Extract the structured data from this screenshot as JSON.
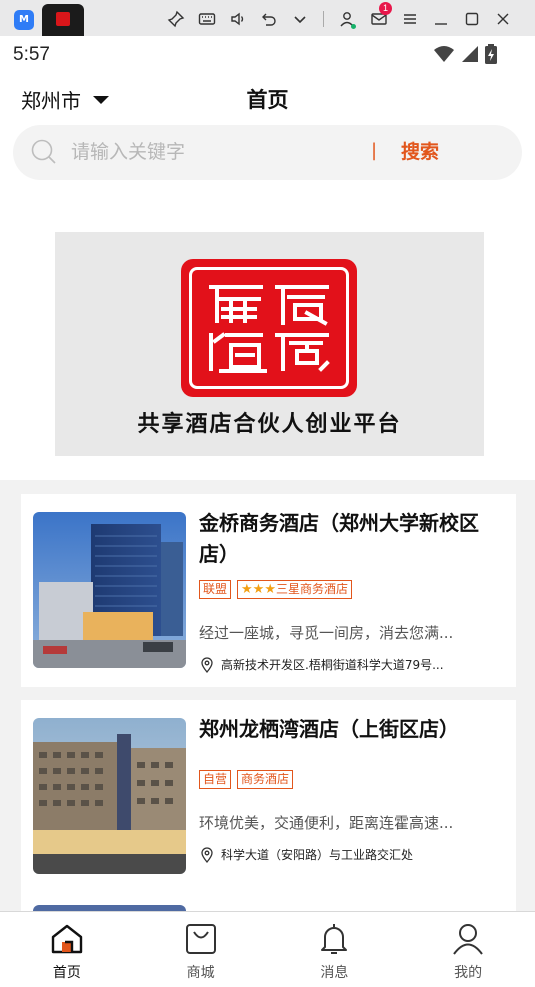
{
  "emulator": {
    "app_icon_text": "M",
    "icons": [
      "pin-icon",
      "keyboard-icon",
      "volume-icon",
      "undo-icon",
      "chevron-down-icon",
      "account-icon",
      "mail-icon",
      "menu-icon",
      "minimize-icon",
      "maximize-icon",
      "close-icon"
    ],
    "mail_badge": "1"
  },
  "status_bar": {
    "time": "5:57"
  },
  "header": {
    "city": "郑州市",
    "title": "首页"
  },
  "search": {
    "placeholder": "请输入关键字",
    "divider": "|",
    "button_label": "搜索"
  },
  "banner": {
    "slogan": "共享酒店合伙人创业平台"
  },
  "hotels": [
    {
      "name": "金桥商务酒店（郑州大学新校区店）",
      "tags": [
        "联盟",
        "三星商务酒店"
      ],
      "star_count": 3,
      "description": "经过一座城，寻觅一间房，消去您满...",
      "address": "高新技术开发区.梧桐街道科学大道79号..."
    },
    {
      "name": "郑州龙栖湾酒店（上街区店）",
      "tags": [
        "自营",
        "商务酒店"
      ],
      "star_count": 0,
      "description": "环境优美，交通便利，距离连霍高速...",
      "address": "科学大道（安阳路）与工业路交汇处"
    }
  ],
  "bottom_nav": [
    {
      "label": "首页",
      "icon": "home-icon",
      "active": true
    },
    {
      "label": "商城",
      "icon": "shopping-bag-icon",
      "active": false
    },
    {
      "label": "消息",
      "icon": "bell-icon",
      "active": false
    },
    {
      "label": "我的",
      "icon": "user-icon",
      "active": false
    }
  ],
  "colors": {
    "accent": "#e2561c",
    "seal_red": "#e2111a",
    "star": "#f3a014",
    "background": "#f2f2f2"
  }
}
